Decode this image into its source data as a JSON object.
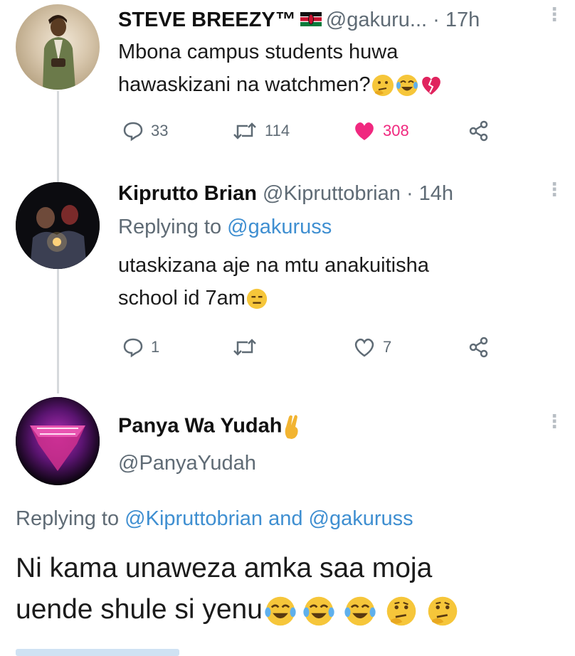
{
  "tweets": [
    {
      "author": "STEVE BREEZY™",
      "handle": "@gakuru...",
      "sep": "·",
      "time": "17h",
      "lines": [
        "Mbona campus students huwa",
        "hawaskizani na watchmen?"
      ],
      "replies": "33",
      "retweets": "114",
      "likes": "308",
      "liked": true
    },
    {
      "author": "Kiprutto Brian",
      "handle": "@Kipruttobrian",
      "sep": "·",
      "time": "14h",
      "replying_label": "Replying to",
      "replying_handle": "@gakuruss",
      "lines": [
        "utaskizana aje na mtu anakuitisha",
        "school id 7am"
      ],
      "replies": "1",
      "likes": "7"
    },
    {
      "author": "Panya Wa Yudah",
      "handle": "@PanyaYudah",
      "replying_label": "Replying to",
      "replying_handle_1": "@Kipruttobrian",
      "replying_and": "and",
      "replying_handle_2": "@gakuruss",
      "lines": [
        "Ni kama unaweza amka saa moja",
        "uende shule si yenu"
      ]
    }
  ],
  "colors": {
    "like_active": "#f0287f",
    "link": "#3f8fd1",
    "muted": "#5f6b75"
  },
  "icons": [
    "reply-icon",
    "retweet-icon",
    "like-icon",
    "share-icon",
    "more-icon"
  ]
}
